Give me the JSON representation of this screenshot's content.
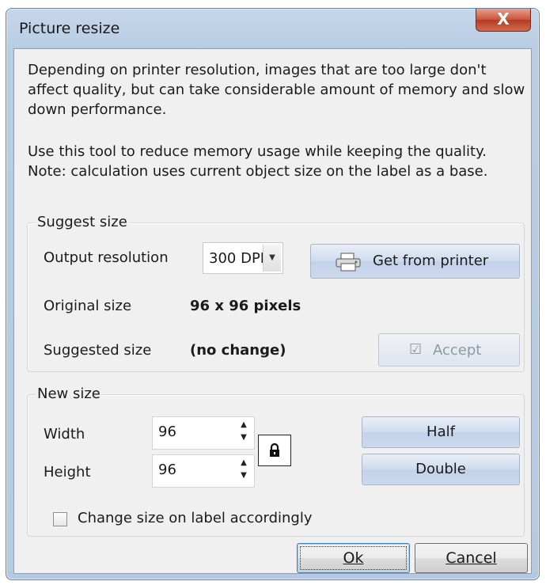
{
  "window": {
    "title": "Picture resize",
    "close_label": "X"
  },
  "description": {
    "para1": "Depending on printer resolution, images that are too large don't affect quality, but can take considerable amount of memory and slow down performance.",
    "para2": "Use this tool to reduce memory usage while keeping the quality. Note: calculation uses current object size on the label as a base."
  },
  "suggest": {
    "group_title": "Suggest size",
    "output_resolution_label": "Output resolution",
    "resolution_value": "300 DPI",
    "get_from_printer_label": "Get from printer",
    "original_size_label": "Original size",
    "original_size_value": "96 x 96 pixels",
    "suggested_size_label": "Suggested size",
    "suggested_size_value": "(no change)",
    "accept_label": "Accept"
  },
  "new_size": {
    "group_title": "New size",
    "width_label": "Width",
    "width_value": "96",
    "height_label": "Height",
    "height_value": "96",
    "half_label": "Half",
    "double_label": "Double",
    "change_label_text": "Change size on label accordingly",
    "change_label_checked": false
  },
  "buttons": {
    "ok_label": "Ok",
    "cancel_label": "Cancel"
  },
  "colors": {
    "title_bar": "#b8cde4",
    "close_button": "#c8533c",
    "action_button": "#c2d2ea"
  },
  "icons": {
    "printer": "printer-icon",
    "accept": "checkmark-icon",
    "lock": "lock-icon"
  }
}
